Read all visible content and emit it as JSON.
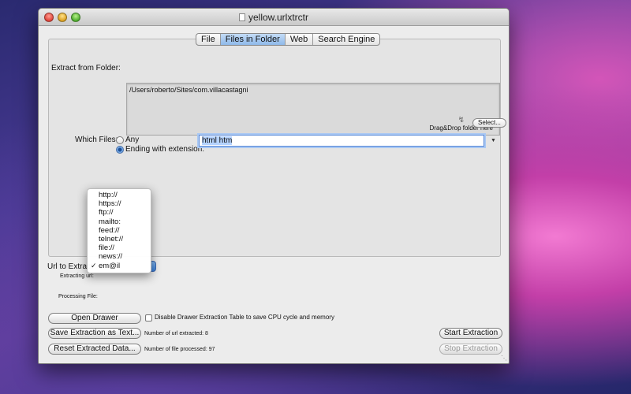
{
  "window": {
    "title": "yellow.urlxtrctr"
  },
  "tabs": [
    {
      "label": "File",
      "active": false
    },
    {
      "label": "Files in Folder",
      "active": true
    },
    {
      "label": "Web",
      "active": false
    },
    {
      "label": "Search Engine",
      "active": false
    }
  ],
  "folder": {
    "label": "Extract from Folder:",
    "path": "/Users/roberto/Sites/com.villacastagni",
    "drop_hint": "Drag&Drop folder here",
    "select_button": "Select..."
  },
  "which_files": {
    "label": "Which Files:",
    "option_any": "Any",
    "option_extension": "Ending with extension:",
    "selected": "extension",
    "extension_value": "html htm"
  },
  "url_menu": {
    "label": "Url to Extract",
    "items": [
      "http://",
      "https://",
      "ftp://",
      "mailto:",
      "feed://",
      "telnet://",
      "file://",
      "news://",
      "em@il"
    ],
    "checked_item": "em@il"
  },
  "status": {
    "extracting_url_label": "Extracting url:",
    "processing_file_label": "Processing File:",
    "urls_extracted": "Number of url extracted: 8",
    "files_processed": "Number of file processed: 97"
  },
  "buttons": {
    "open_drawer": "Open Drawer",
    "save_extraction": "Save Extraction as Text...",
    "reset_data": "Reset Extracted Data...",
    "start_extraction": "Start Extraction",
    "stop_extraction": "Stop Extraction"
  },
  "options": {
    "disable_drawer_label": "Disable Drawer Extraction Table to save CPU cycle and memory",
    "disable_drawer_checked": false
  },
  "colors": {
    "accent": "#3a7fd8",
    "selection": "#b5d3ff"
  }
}
